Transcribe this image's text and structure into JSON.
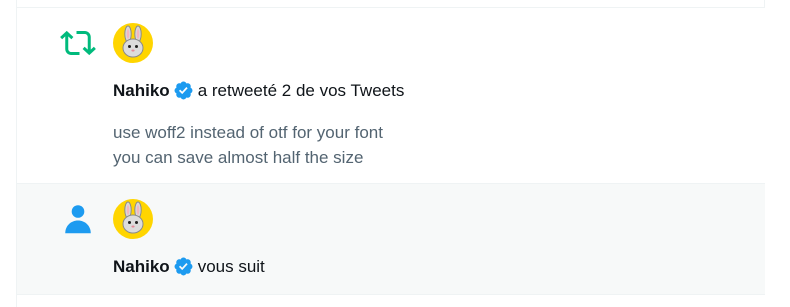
{
  "notifications": [
    {
      "type_icon": "retweet-icon",
      "avatar": "bunny-avatar",
      "user_name": "Nahiko",
      "action_text": "a retweeté 2 de vos Tweets",
      "tweet_lines": [
        "use woff2 instead of otf for your font",
        "you can save almost half the size"
      ]
    },
    {
      "type_icon": "person-icon",
      "avatar": "bunny-avatar",
      "user_name": "Nahiko",
      "action_text": "vous suit"
    }
  ],
  "colors": {
    "retweet_green": "#00ba7c",
    "follow_blue": "#1d9bf0",
    "verified_blue": "#1d9bf0",
    "avatar_bg": "#ffd500",
    "secondary_text": "#536471"
  }
}
